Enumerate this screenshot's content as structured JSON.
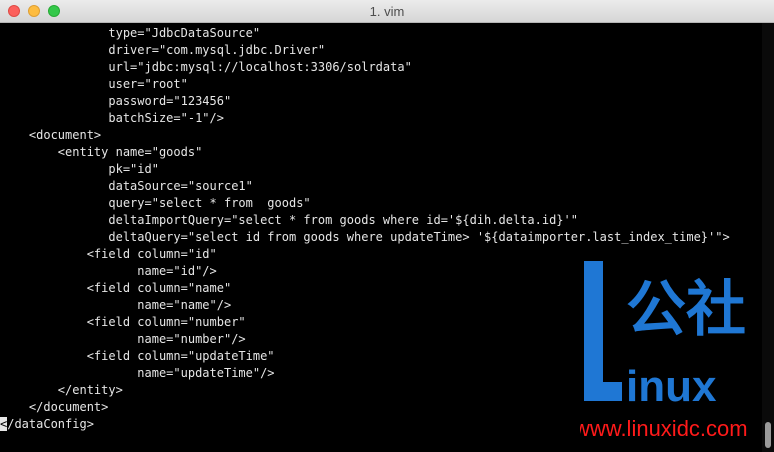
{
  "window": {
    "title": "1. vim"
  },
  "lines": [
    "               type=\"JdbcDataSource\"",
    "               driver=\"com.mysql.jdbc.Driver\"",
    "               url=\"jdbc:mysql://localhost:3306/solrdata\"",
    "               user=\"root\"",
    "               password=\"123456\"",
    "               batchSize=\"-1\"/>",
    "    <document>",
    "        <entity name=\"goods\"",
    "               pk=\"id\"",
    "               dataSource=\"source1\"",
    "               query=\"select * from  goods\"",
    "               deltaImportQuery=\"select * from goods where id='${dih.delta.id}'\"",
    "               deltaQuery=\"select id from goods where updateTime> '${dataimporter.last_index_time}'\">",
    "            <field column=\"id\"",
    "                   name=\"id\"/>",
    "            <field column=\"name\"",
    "                   name=\"name\"/>",
    "            <field column=\"number\"",
    "                   name=\"number\"/>",
    "            <field column=\"updateTime\"",
    "                   name=\"updateTime\"/>",
    "        </entity>",
    "    </document>",
    "/dataConfig>"
  ],
  "cursor_char": "<",
  "watermark": {
    "chinese": "公社",
    "word": "inux",
    "url": "www.linuxidc.com",
    "colors": {
      "blue": "#1f77d4",
      "red": "#ff1a1a"
    }
  }
}
